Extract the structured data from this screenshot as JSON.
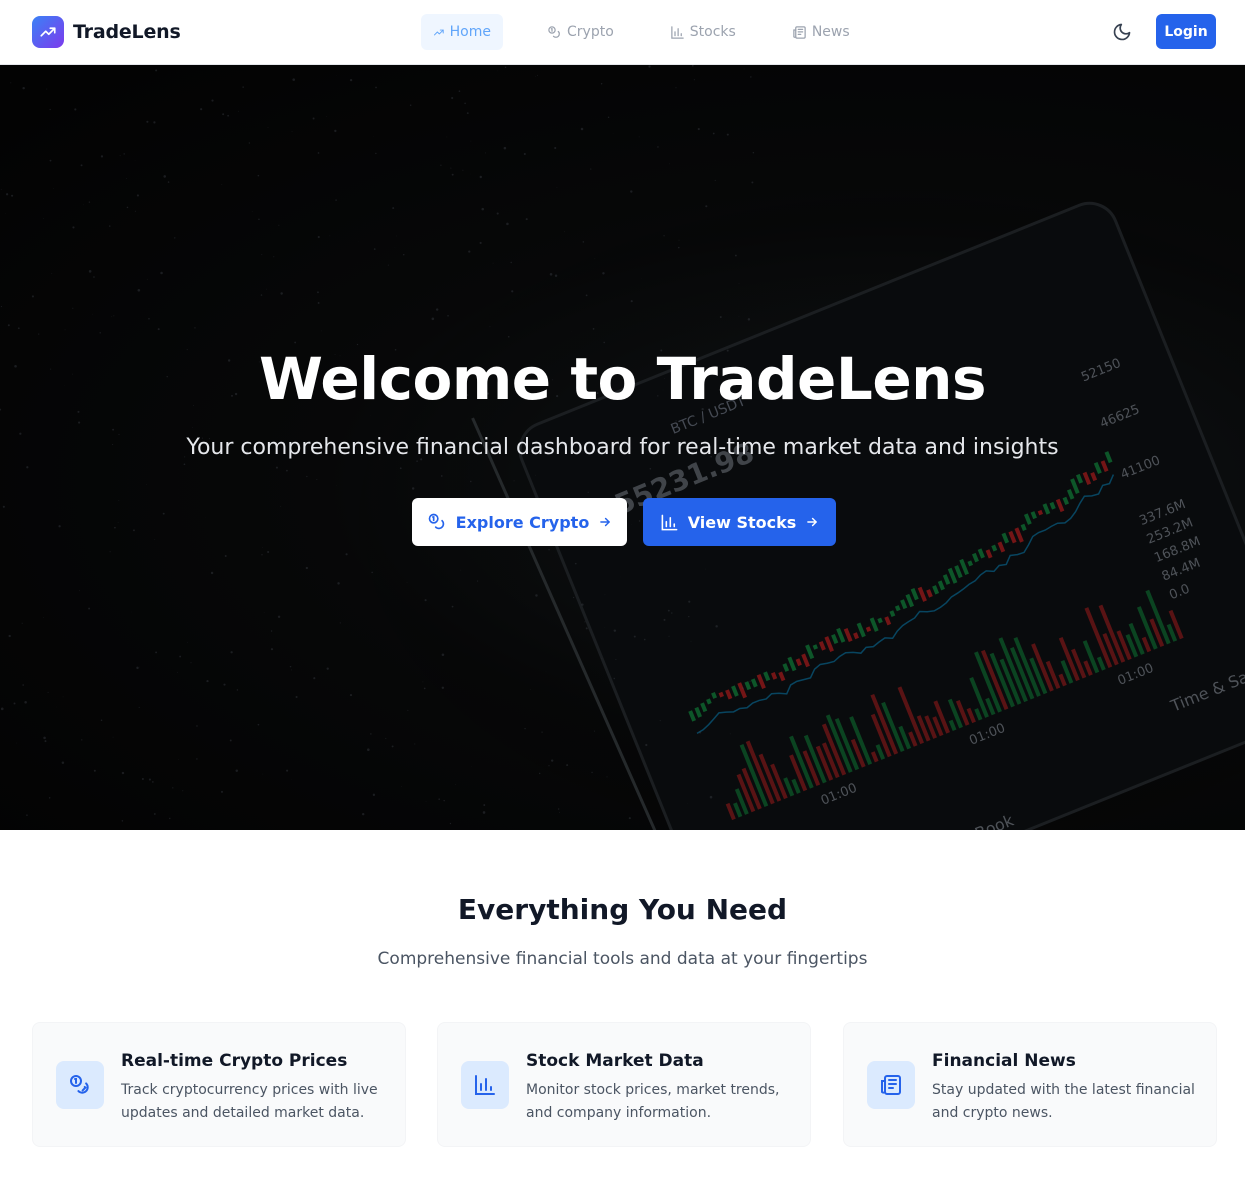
{
  "nav": {
    "brand": "TradeLens",
    "links": [
      {
        "label": "Home",
        "icon": "trending-up-icon",
        "active": true
      },
      {
        "label": "Crypto",
        "icon": "coins-icon",
        "active": false
      },
      {
        "label": "Stocks",
        "icon": "bar-chart-icon",
        "active": false
      },
      {
        "label": "News",
        "icon": "newspaper-icon",
        "active": false
      }
    ],
    "theme_icon": "moon-icon",
    "login_label": "Login"
  },
  "hero": {
    "title": "Welcome to TradeLens",
    "subtitle": "Your comprehensive financial dashboard for real-time market data and insights",
    "explore_label": "Explore Crypto",
    "stocks_label": "View Stocks",
    "background_texts": {
      "pair": "BTC / USDT",
      "price": "55231.98",
      "axis_values": [
        "52150",
        "46625",
        "41100",
        "337.6M",
        "253.2M",
        "168.8M",
        "84.4M",
        "0.0"
      ],
      "time_labels": [
        "01:00",
        "01:00",
        "01:00"
      ],
      "panel_label": "Time & Sales",
      "book_label": "Order Book"
    }
  },
  "features": {
    "title": "Everything You Need",
    "subtitle": "Comprehensive financial tools and data at your fingertips",
    "cards": [
      {
        "icon": "coins-icon",
        "title": "Real-time Crypto Prices",
        "description": "Track cryptocurrency prices with live updates and detailed market data."
      },
      {
        "icon": "bar-chart-icon",
        "title": "Stock Market Data",
        "description": "Monitor stock prices, market trends, and company information."
      },
      {
        "icon": "newspaper-icon",
        "title": "Financial News",
        "description": "Stay updated with the latest financial and crypto news."
      }
    ]
  },
  "colors": {
    "accent": "#2563eb",
    "accent_light": "#dbeafe",
    "brand_gradient_start": "#3b82f6",
    "brand_gradient_end": "#7c3aed",
    "hero_bg": "#0b0c0d",
    "candle_up": "#16a34a",
    "candle_down": "#dc2626"
  }
}
